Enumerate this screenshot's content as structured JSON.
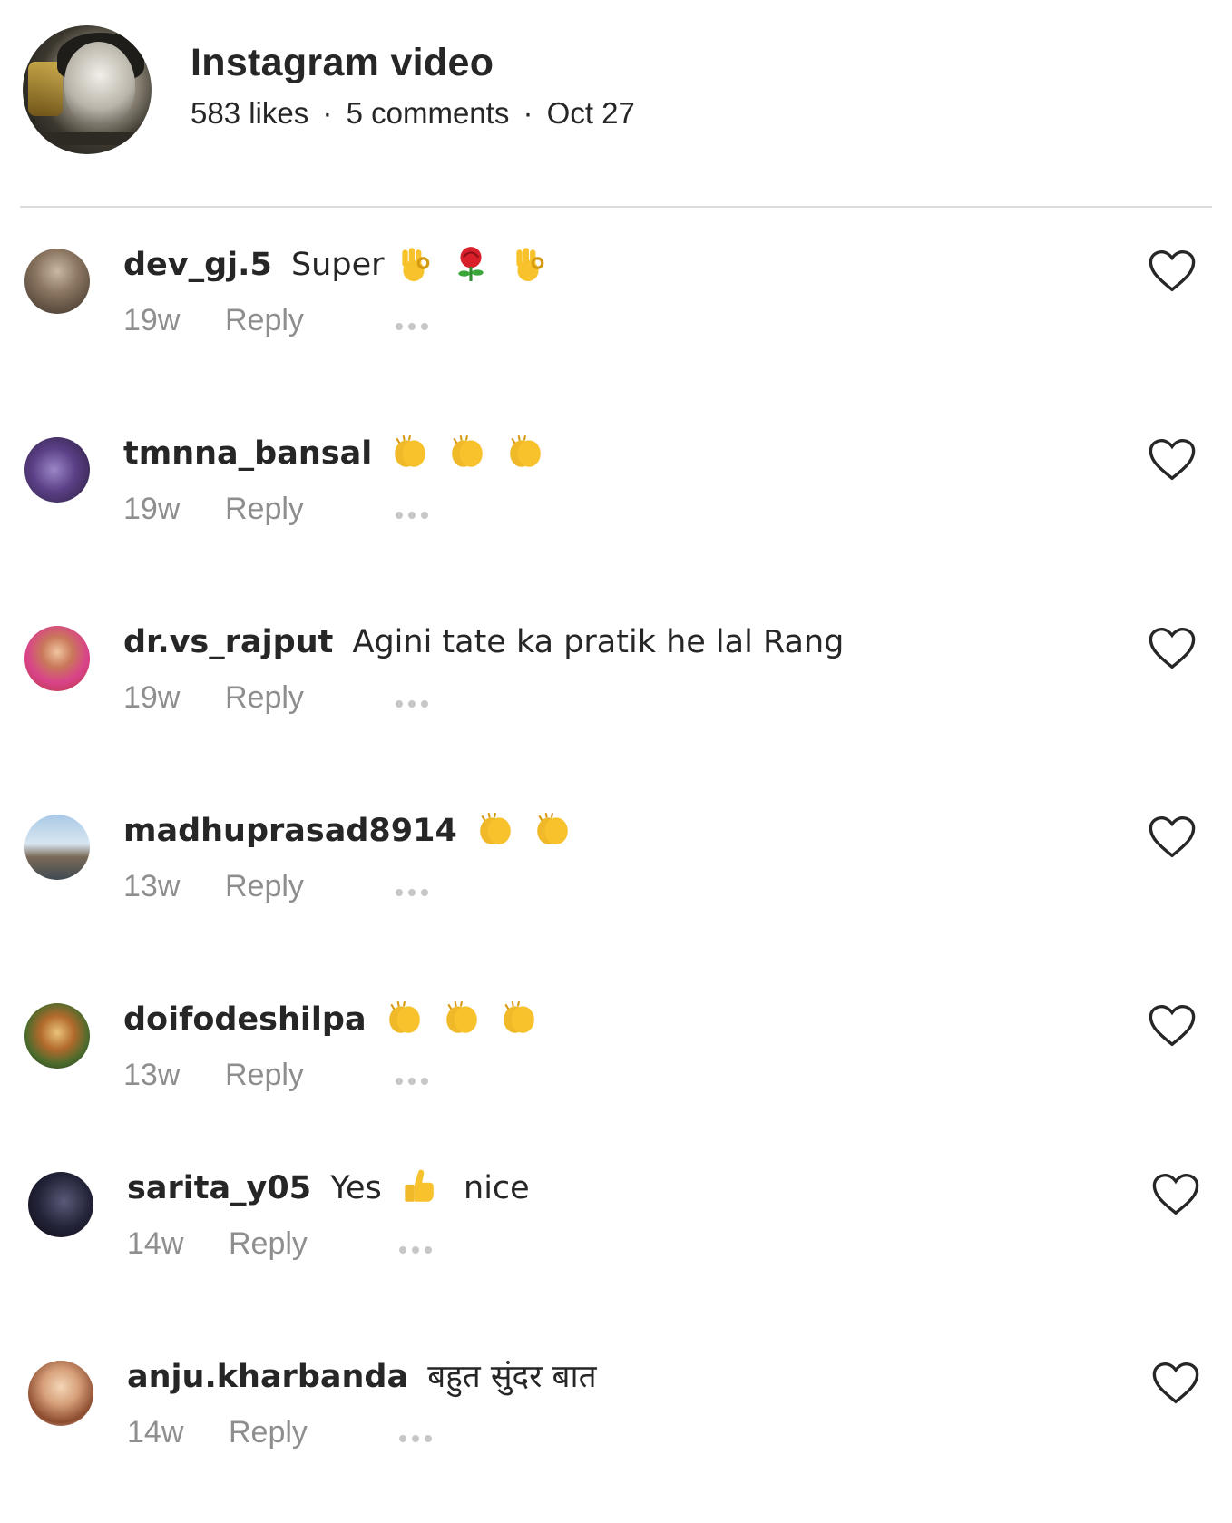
{
  "post": {
    "title": "Instagram video",
    "likes": "583 likes",
    "comments": "5 comments",
    "date": "Oct 27",
    "separator": "·"
  },
  "comments": [
    {
      "username": "dev_gj.5",
      "text": "Super",
      "emojis": [
        "ok-hand",
        "rose",
        "ok-hand"
      ],
      "time": "19w",
      "reply": "Reply"
    },
    {
      "username": "tmnna_bansal",
      "text": "",
      "emojis": [
        "clapping-hands",
        "clapping-hands",
        "clapping-hands"
      ],
      "time": "19w",
      "reply": "Reply"
    },
    {
      "username": "dr.vs_rajput",
      "text": "Agini tate ka pratik he lal Rang",
      "emojis": [],
      "time": "19w",
      "reply": "Reply"
    },
    {
      "username": "madhuprasad8914",
      "text": "",
      "emojis": [
        "clapping-hands",
        "clapping-hands"
      ],
      "time": "13w",
      "reply": "Reply"
    },
    {
      "username": "doifodeshilpa",
      "text": "",
      "emojis": [
        "clapping-hands",
        "clapping-hands",
        "clapping-hands"
      ],
      "time": "13w",
      "reply": "Reply"
    },
    {
      "username": "sarita_y05",
      "text": "Yes",
      "emojis": [
        "thumbs-up"
      ],
      "text_after": "nice",
      "time": "14w",
      "reply": "Reply"
    },
    {
      "username": "anju.kharbanda",
      "text": "बहुत सुंदर बात",
      "emojis": [],
      "time": "14w",
      "reply": "Reply"
    }
  ],
  "colors": {
    "text": "#262626",
    "muted": "#8e8e8e",
    "divider": "#dbdbdb",
    "emoji_yellow": "#f7c22b"
  },
  "icons": {
    "like": "heart-outline-icon",
    "more": "more-options-icon"
  }
}
